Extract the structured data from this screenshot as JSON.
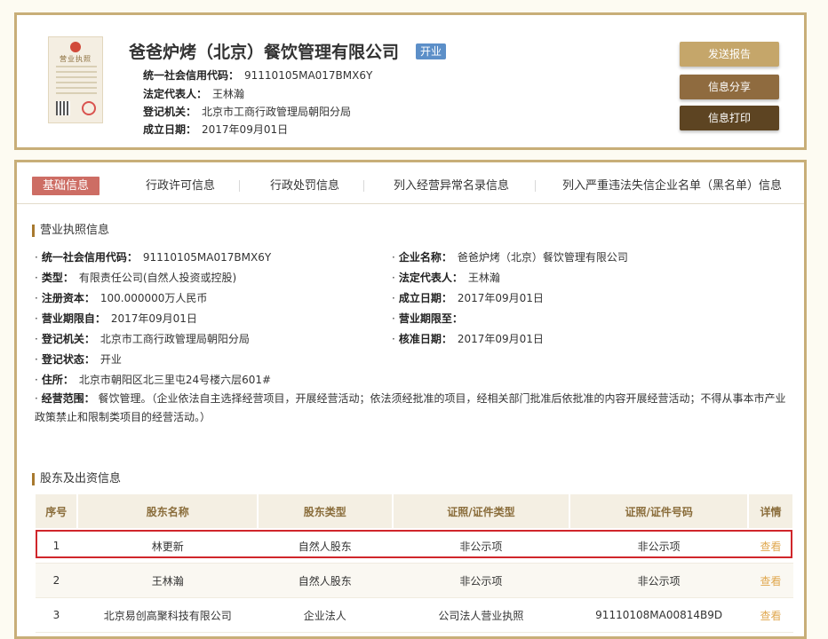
{
  "header": {
    "company_name": "爸爸炉烤（北京）餐饮管理有限公司",
    "status": "开业",
    "license_thumb_title": "营业执照",
    "meta": [
      {
        "label": "统一社会信用代码：",
        "value": "91110105MA017BMX6Y"
      },
      {
        "label": "法定代表人：",
        "value": "王林瀚"
      },
      {
        "label": "登记机关：",
        "value": "北京市工商行政管理局朝阳分局"
      },
      {
        "label": "成立日期：",
        "value": "2017年09月01日"
      }
    ],
    "actions": [
      {
        "label": "发送报告",
        "color": "#c5a66a"
      },
      {
        "label": "信息分享",
        "color": "#8f6b3f"
      },
      {
        "label": "信息打印",
        "color": "#5d4422"
      }
    ]
  },
  "tabs": [
    {
      "label": "基础信息",
      "active": true
    },
    {
      "label": "行政许可信息"
    },
    {
      "label": "行政处罚信息"
    },
    {
      "label": "列入经营异常名录信息"
    },
    {
      "label": "列入严重违法失信企业名单（黑名单）信息"
    }
  ],
  "license_section": {
    "title": "营业执照信息",
    "left": [
      {
        "label": "统一社会信用代码：",
        "value": "91110105MA017BMX6Y"
      },
      {
        "label": "类型：",
        "value": "有限责任公司(自然人投资或控股)"
      },
      {
        "label": "注册资本：",
        "value": "100.000000万人民币"
      },
      {
        "label": "营业期限自：",
        "value": "2017年09月01日"
      },
      {
        "label": "登记机关：",
        "value": "北京市工商行政管理局朝阳分局"
      },
      {
        "label": "登记状态：",
        "value": "开业"
      },
      {
        "label": "住所：",
        "value": "北京市朝阳区北三里屯24号楼六层601#"
      }
    ],
    "right": [
      {
        "label": "企业名称：",
        "value": "爸爸炉烤（北京）餐饮管理有限公司"
      },
      {
        "label": "法定代表人：",
        "value": "王林瀚"
      },
      {
        "label": "成立日期：",
        "value": "2017年09月01日"
      },
      {
        "label": "营业期限至：",
        "value": ""
      },
      {
        "label": "核准日期：",
        "value": "2017年09月01日"
      }
    ],
    "scope_label": "经营范围：",
    "scope_value": "餐饮管理。（企业依法自主选择经营项目，开展经营活动；依法须经批准的项目，经相关部门批准后依批准的内容开展经营活动；不得从事本市产业政策禁止和限制类项目的经营活动。）"
  },
  "shareholder_section": {
    "title": "股东及出资信息",
    "columns": [
      "序号",
      "股东名称",
      "股东类型",
      "证照/证件类型",
      "证照/证件号码",
      "详情"
    ],
    "rows": [
      {
        "no": "1",
        "name": "林更新",
        "type": "自然人股东",
        "id_type": "非公示项",
        "id_no": "非公示项",
        "detail": "查看"
      },
      {
        "no": "2",
        "name": "王林瀚",
        "type": "自然人股东",
        "id_type": "非公示项",
        "id_no": "非公示项",
        "detail": "查看"
      },
      {
        "no": "3",
        "name": "北京易创高聚科技有限公司",
        "type": "企业法人",
        "id_type": "公司法人营业执照",
        "id_no": "91110108MA00814B9D",
        "detail": "查看"
      }
    ]
  },
  "colors": {
    "border": "#c8ae78",
    "active_tab": "#cd6d64",
    "badge": "#5c8fc8",
    "highlight": "#d0262b",
    "link": "#e0a850"
  }
}
